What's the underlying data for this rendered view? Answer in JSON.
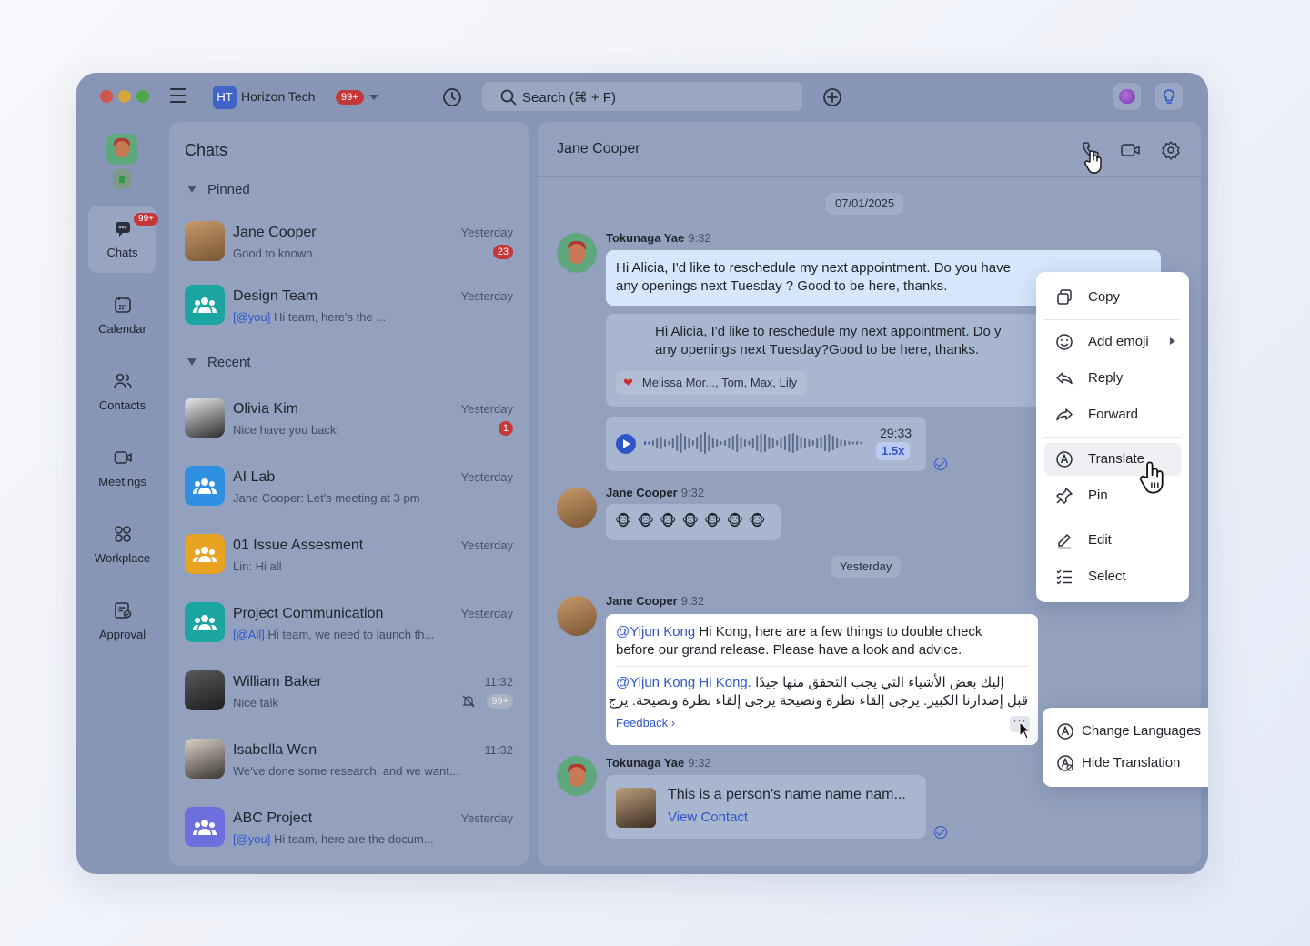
{
  "window": {
    "workspace_logo": "HT",
    "workspace_name": "Horizon Tech",
    "workspace_badge": "99+",
    "search_placeholder": "Search (⌘ + F)"
  },
  "rail": {
    "items": [
      {
        "label": "Chats",
        "badge": "99+",
        "icon": "chat-icon",
        "active": true
      },
      {
        "label": "Calendar",
        "icon": "calendar-icon"
      },
      {
        "label": "Contacts",
        "icon": "contacts-icon"
      },
      {
        "label": "Meetings",
        "icon": "meetings-icon"
      },
      {
        "label": "Workplace",
        "icon": "workplace-icon"
      },
      {
        "label": "Approval",
        "icon": "approval-icon"
      }
    ]
  },
  "chat_list": {
    "title": "Chats",
    "pinned_label": "Pinned",
    "recent_label": "Recent",
    "pinned": [
      {
        "name": "Jane Cooper",
        "preview": "Good to known.",
        "time": "Yesterday",
        "count": "23"
      },
      {
        "name": "Design Team",
        "mention": "[@you]",
        "preview": " Hi team, here's the ...",
        "time": "Yesterday"
      }
    ],
    "recent": [
      {
        "name": "Olivia Kim",
        "preview": "Nice have you back!",
        "time": "Yesterday",
        "count": "1"
      },
      {
        "name": "AI Lab",
        "preview": "Jane Cooper: Let's meeting at 3 pm",
        "time": "Yesterday"
      },
      {
        "name": "01 Issue Assesment",
        "preview": "Lin: Hi all",
        "time": "Yesterday"
      },
      {
        "name": "Project Communication",
        "mention": "[@All]",
        "preview": " Hi team, we need to launch th...",
        "time": "Yesterday"
      },
      {
        "name": "William Baker",
        "preview": "Nice talk",
        "time": "11:32",
        "count": "99+"
      },
      {
        "name": "Isabella Wen",
        "preview": "We've done some research, and we want...",
        "time": "11:32"
      },
      {
        "name": "ABC Project",
        "mention": "[@you]",
        "preview": " Hi team, here are the docum...",
        "time": "Yesterday"
      }
    ]
  },
  "conversation": {
    "title": "Jane Cooper",
    "date_1": "07/01/2025",
    "date_2": "Yesterday",
    "msg1": {
      "sender": "Tokunaga Yae",
      "time": "9:32",
      "text_line1": "Hi Alicia, I'd like to reschedule my next appointment. Do you have",
      "text_line2": "any openings next Tuesday ? Good to be here, thanks."
    },
    "msg2": {
      "text_line1": "Hi Alicia, I'd like to reschedule my next appointment. Do y",
      "text_line2": "any openings next Tuesday?Good to be here, thanks.",
      "reactions": "Melissa Mor..., Tom, Max, Lily"
    },
    "voice": {
      "duration": "29:33",
      "speed": "1.5x"
    },
    "msg3": {
      "sender": "Jane Cooper",
      "time": "9:32",
      "emojis": "🐵🐵🐵🐵🐵🐵🐵"
    },
    "msg4": {
      "sender": "Jane Cooper",
      "time": "9:32",
      "mention": "@Yijun Kong",
      "text_line1": " Hi Kong, here are a few things to double check",
      "text_line2": "before our grand release. Please have a look and advice.",
      "translation_mention": "@Yijun Kong Hi Kong.",
      "translation_line1": "إليك بعض الأشياء التي يجب التحقق منها جيدًا",
      "translation_line2": "قبل إصدارنا الكبير. يرجى إلقاء نظرة ونصيحة يرجى إلقاء نظرة ونصيحة. يرج",
      "feedback": "Feedback",
      "more": "···"
    },
    "msg5": {
      "sender": "Tokunaga Yae",
      "time": "9:32",
      "contact_name": "This is a person's name  name nam...",
      "contact_link": "View Contact"
    }
  },
  "context_menu": {
    "items": [
      {
        "label": "Copy",
        "icon": "copy-icon"
      },
      {
        "label": "Add emoji",
        "icon": "emoji-icon"
      },
      {
        "label": "Reply",
        "icon": "reply-icon"
      },
      {
        "label": "Forward",
        "icon": "forward-icon"
      },
      {
        "label": "Translate",
        "icon": "translate-icon"
      },
      {
        "label": "Pin",
        "icon": "pin-icon"
      },
      {
        "label": "Edit",
        "icon": "edit-icon"
      },
      {
        "label": "Select",
        "icon": "select-icon"
      }
    ]
  },
  "translation_menu": {
    "change_languages": "Change Languages",
    "hide_translation": "Hide Translation"
  },
  "colors": {
    "accent": "#2f56c7",
    "badge": "#c5383a",
    "window_overlay": "#8796b7"
  }
}
